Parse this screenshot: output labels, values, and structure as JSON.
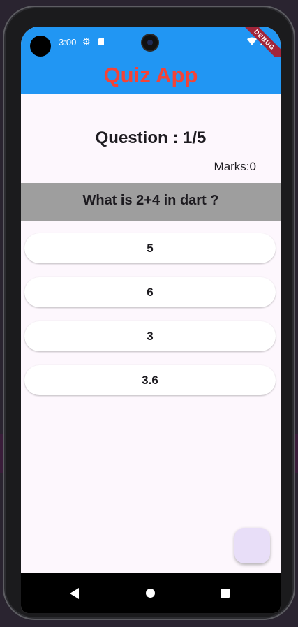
{
  "status_bar": {
    "time": "3:00",
    "debug_banner": "DEBUG"
  },
  "app_bar": {
    "title": "Quiz App"
  },
  "quiz": {
    "counter": "Question : 1/5",
    "marks": "Marks:0",
    "question": "What is 2+4 in dart ?",
    "options": [
      "5",
      "6",
      "3",
      "3.6"
    ]
  },
  "colors": {
    "app_bar": "#2196f3",
    "title": "#f44336",
    "question_band": "#9e9e9e",
    "background": "#fdf7fd",
    "fab": "#e8def8"
  },
  "icons": {
    "status": [
      "settings-gear-icon",
      "sd-card-icon",
      "wifi-icon",
      "signal-icon"
    ],
    "navigation": [
      "back-icon",
      "home-icon",
      "recents-icon"
    ]
  }
}
